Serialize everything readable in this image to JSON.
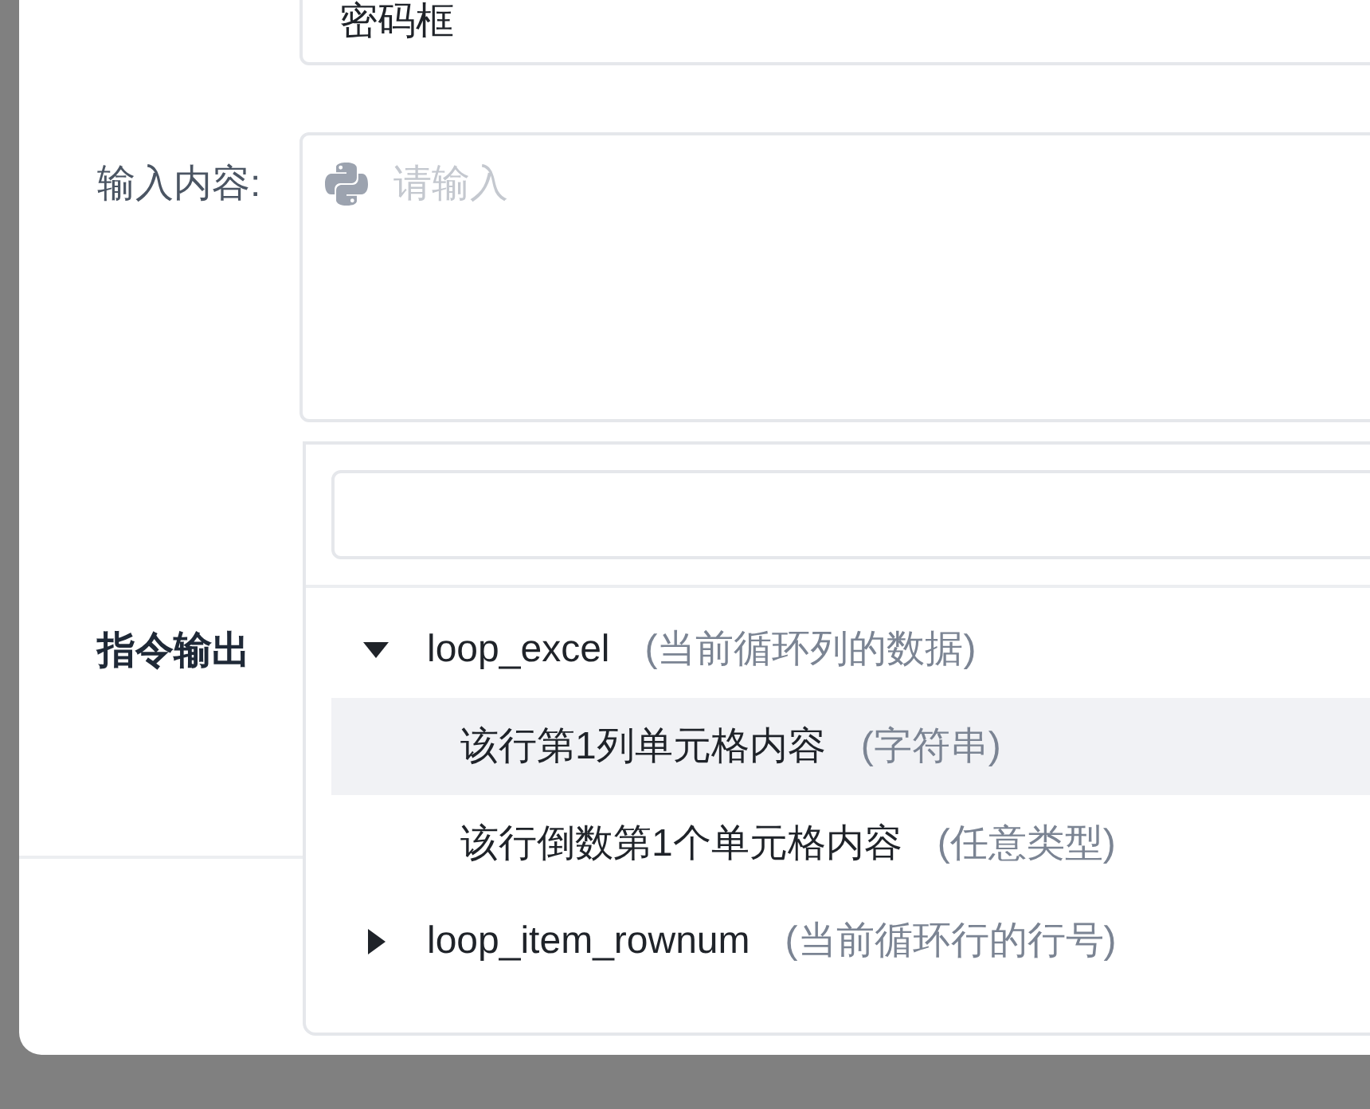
{
  "form": [
    {
      "kind": "text",
      "value": "密码框"
    },
    {
      "kind": "code",
      "label": "输入内容:",
      "placeholder": "请输入"
    },
    {
      "kind": "select",
      "label": "指令输出"
    }
  ],
  "dropdown": {
    "tree": [
      {
        "name": "loop_excel",
        "description": "(当前循环列的数据)",
        "expanded": true,
        "selected": false,
        "children": [
          {
            "name": "该行第1列单元格内容",
            "description": "(字符串)",
            "selected": true
          },
          {
            "name": "该行倒数第1个单元格内容",
            "description": "(任意类型)",
            "selected": false
          }
        ]
      },
      {
        "name": "loop_item_rownum",
        "description": "(当前循环行的行号)",
        "expanded": false,
        "selected": false
      }
    ]
  }
}
